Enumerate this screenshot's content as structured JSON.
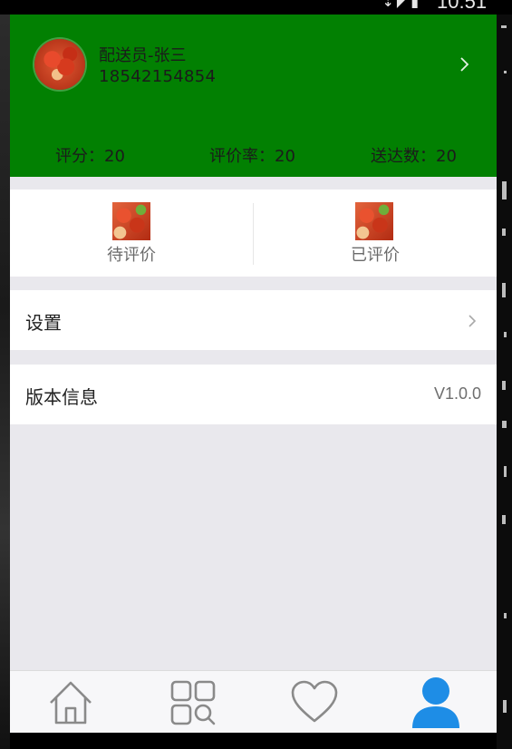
{
  "status_bar": {
    "time": "10:51"
  },
  "profile": {
    "name": "配送员-张三",
    "phone": "18542154854"
  },
  "stats": {
    "score": "评分：20",
    "rate": "评价率：20",
    "delivered": "送达数：20"
  },
  "reviews": {
    "tabs": [
      {
        "label": "待评价"
      },
      {
        "label": "已评价"
      }
    ]
  },
  "menu": {
    "settings_label": "设置",
    "version_label": "版本信息",
    "version_value": "V1.0.0"
  },
  "bottom_nav": {
    "items": [
      {
        "icon": "home-icon",
        "active": false
      },
      {
        "icon": "category-search-icon",
        "active": false
      },
      {
        "icon": "heart-icon",
        "active": false
      },
      {
        "icon": "person-icon",
        "active": true
      }
    ]
  },
  "colors": {
    "header_bg": "#028002",
    "page_bg": "#e9e8ed",
    "nav_active": "#1e8de6",
    "nav_inactive": "#8a8a8a"
  }
}
